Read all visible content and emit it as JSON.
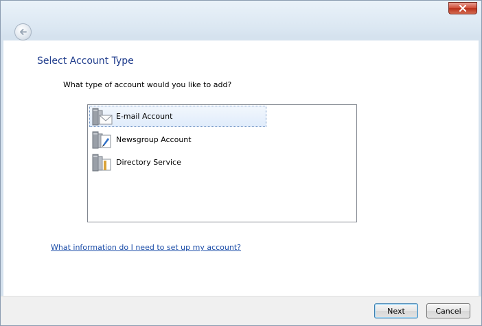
{
  "page": {
    "title": "Select Account Type",
    "question": "What type of account would you like to add?",
    "help_link": "What information do I need to set up my account?"
  },
  "account_types": [
    {
      "label": "E-mail Account",
      "icon": "email-account-icon",
      "selected": true
    },
    {
      "label": "Newsgroup Account",
      "icon": "newsgroup-account-icon",
      "selected": false
    },
    {
      "label": "Directory Service",
      "icon": "directory-service-icon",
      "selected": false
    }
  ],
  "buttons": {
    "next": "Next",
    "cancel": "Cancel"
  },
  "icons": {
    "close": "close-icon",
    "back": "back-arrow-icon"
  },
  "colors": {
    "title_text": "#1f3c8c",
    "link_text": "#1a4ca8",
    "close_button": "#cf4a34"
  }
}
